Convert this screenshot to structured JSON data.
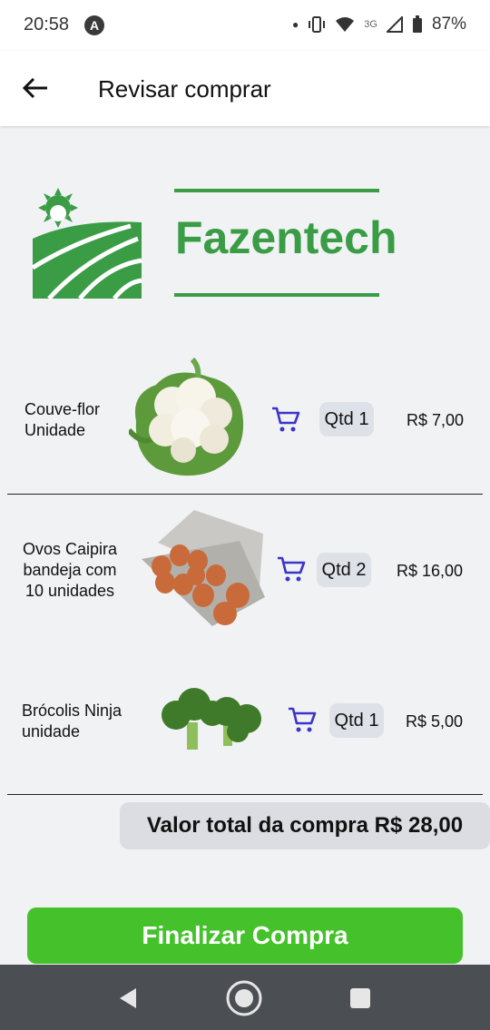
{
  "status_bar": {
    "time": "20:58",
    "network": "3G",
    "battery": "87%"
  },
  "app_bar": {
    "back_icon": "arrow-left-icon",
    "title": "Revisar comprar"
  },
  "brand": {
    "name": "Fazentech",
    "color": "#3a9d46"
  },
  "items": [
    {
      "name_line1": "Couve-flor",
      "name_line2": "Unidade",
      "name_line3": "",
      "qty": "Qtd 1",
      "price": "R$ 7,00"
    },
    {
      "name_line1": "Ovos Caipira",
      "name_line2": "bandeja com",
      "name_line3": "10 unidades",
      "qty": "Qtd 2",
      "price": "R$ 16,00"
    },
    {
      "name_line1": "Brócolis Ninja",
      "name_line2": "unidade",
      "name_line3": "",
      "qty": "Qtd 1",
      "price": "R$ 5,00"
    }
  ],
  "total": "Valor total da compra R$ 28,00",
  "finalize_button": "Finalizar Compra",
  "colors": {
    "accent_green": "#45c22b",
    "cart_icon": "#3b35c9"
  }
}
